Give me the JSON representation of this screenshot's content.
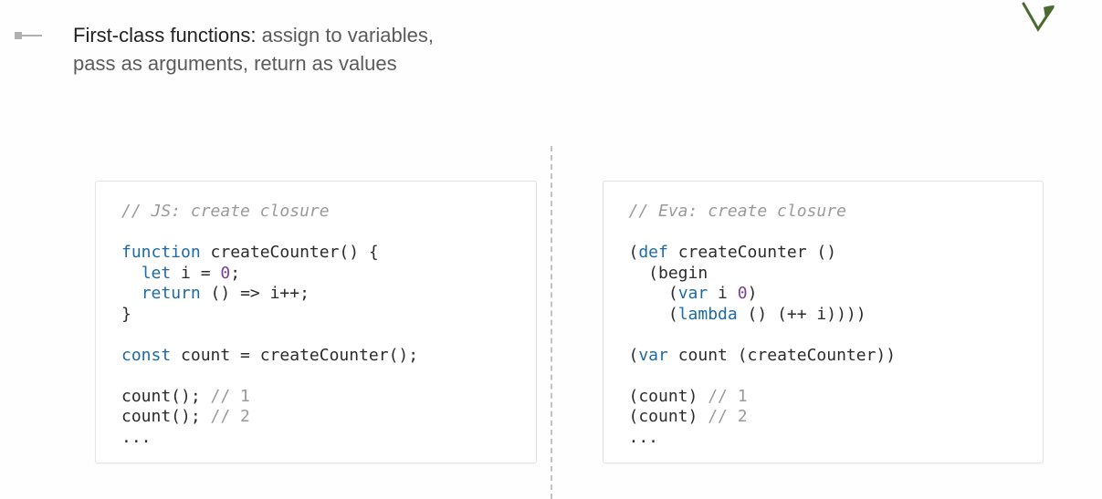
{
  "header": {
    "strong": "First-class functions:",
    "rest_line1": " assign to variables,",
    "line2": "pass as arguments, return as values"
  },
  "left": {
    "comment": "// JS: create closure",
    "fn_kw": "function",
    "fn_sig": " createCounter() {",
    "let_kw": "let",
    "let_rest": " i = ",
    "zero": "0",
    "semi": ";",
    "return_kw": "return",
    "return_rest": " () => i++;",
    "close": "}",
    "const_kw": "const",
    "const_rest": " count = createCounter();",
    "call1_pre": "count();",
    "call1_cmt": " // 1",
    "call2_pre": "count();",
    "call2_cmt": " // 2",
    "dots": "..."
  },
  "right": {
    "comment": "// Eva: create closure",
    "l1_a": "(",
    "l1_kw": "def",
    "l1_b": " createCounter ()",
    "l2": "  (begin",
    "l3_a": "    (",
    "l3_kw": "var",
    "l3_b": " i ",
    "l3_zero": "0",
    "l3_c": ")",
    "l4_a": "    (",
    "l4_kw": "lambda",
    "l4_b": " () (++ i))))",
    "l5_a": "(",
    "l5_kw": "var",
    "l5_b": " count (createCounter))",
    "call1_pre": "(count)",
    "call1_cmt": " // 1",
    "call2_pre": "(count)",
    "call2_cmt": " // 2",
    "dots": "..."
  }
}
